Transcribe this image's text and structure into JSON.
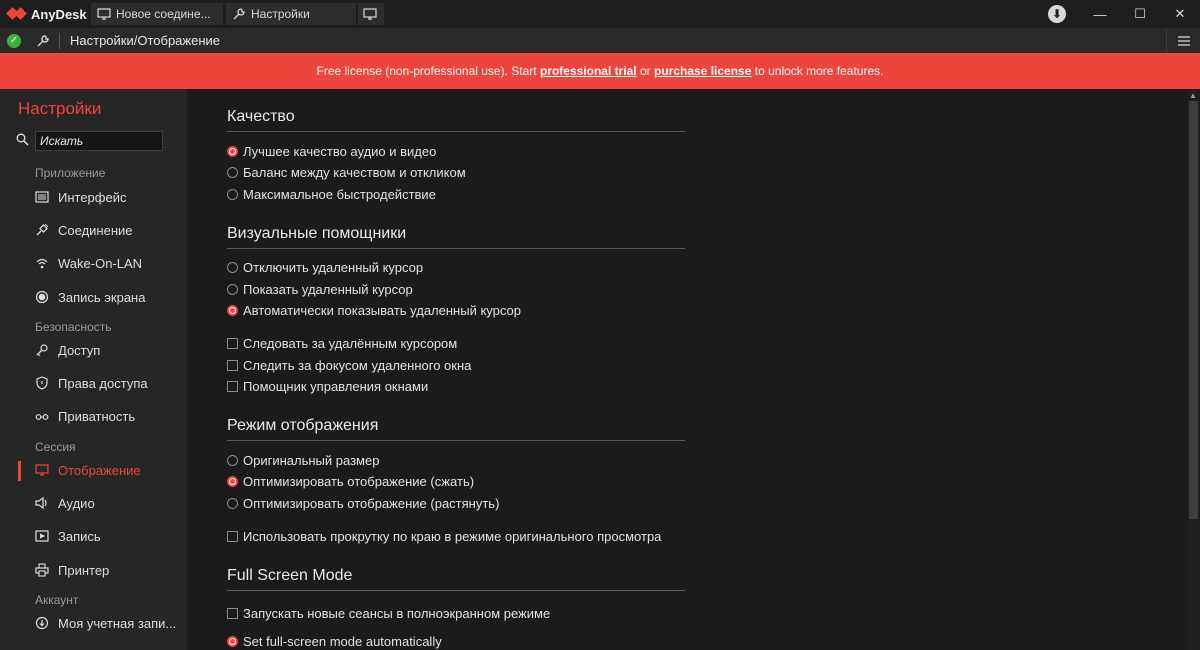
{
  "titlebar": {
    "app_name": "AnyDesk",
    "tabs": [
      {
        "label": "Новое соедине..."
      },
      {
        "label": "Настройки"
      }
    ],
    "minimize": "—",
    "maximize": "☐",
    "close": "✕",
    "download": "⬇"
  },
  "addressbar": {
    "path": "Настройки/Отображение"
  },
  "banner": {
    "prefix": "Free license (non-professional use). Start ",
    "trial_link": "professional trial",
    "or": " or ",
    "purchase_link": "purchase license",
    "suffix": " to unlock more features."
  },
  "sidebar": {
    "title": "Настройки",
    "search_placeholder": "Искать",
    "groups": {
      "app": "Приложение",
      "security": "Безопасность",
      "session": "Сессия",
      "account": "Аккаунт"
    },
    "items": {
      "interface": "Интерфейс",
      "connection": "Соединение",
      "wol": "Wake-On-LAN",
      "screen_record": "Запись экрана",
      "access": "Доступ",
      "permissions": "Права доступа",
      "privacy": "Приватность",
      "display": "Отображение",
      "audio": "Аудио",
      "recording": "Запись",
      "printer": "Принтер",
      "my_account": "Моя учетная запи..."
    }
  },
  "main": {
    "quality": {
      "title": "Качество",
      "options": [
        {
          "label": "Лучшее качество аудио и видео",
          "selected": true
        },
        {
          "label": "Баланс между качеством и откликом",
          "selected": false
        },
        {
          "label": "Максимальное быстродействие",
          "selected": false
        }
      ]
    },
    "visual": {
      "title": "Визуальные помощники",
      "cursor_options": [
        {
          "label": "Отключить удаленный курсор",
          "selected": false
        },
        {
          "label": "Показать удаленный курсор",
          "selected": false
        },
        {
          "label": "Автоматически показывать удаленный курсор",
          "selected": true
        }
      ],
      "checks": [
        {
          "label": "Следовать за удалённым курсором",
          "checked": false
        },
        {
          "label": "Следить за фокусом удаленного окна",
          "checked": false
        },
        {
          "label": "Помощник управления окнами",
          "checked": false
        }
      ]
    },
    "display_mode": {
      "title": "Режим отображения",
      "options": [
        {
          "label": "Оригинальный размер",
          "selected": false
        },
        {
          "label": "Оптимизировать отображение (сжать)",
          "selected": true
        },
        {
          "label": "Оптимизировать отображение (растянуть)",
          "selected": false
        }
      ],
      "edge_scroll": {
        "label": "Использовать прокрутку по краю в режиме оригинального просмотра",
        "checked": false
      }
    },
    "fullscreen": {
      "title": "Full Screen Mode",
      "new_sessions": {
        "label": "Запускать новые сеансы в полноэкранном режиме",
        "checked": false
      },
      "auto": {
        "label": "Set full-screen mode automatically",
        "selected": true
      }
    }
  },
  "colors": {
    "accent": "#ef443b",
    "background": "#1b1b1b",
    "sidebar": "#262626"
  }
}
